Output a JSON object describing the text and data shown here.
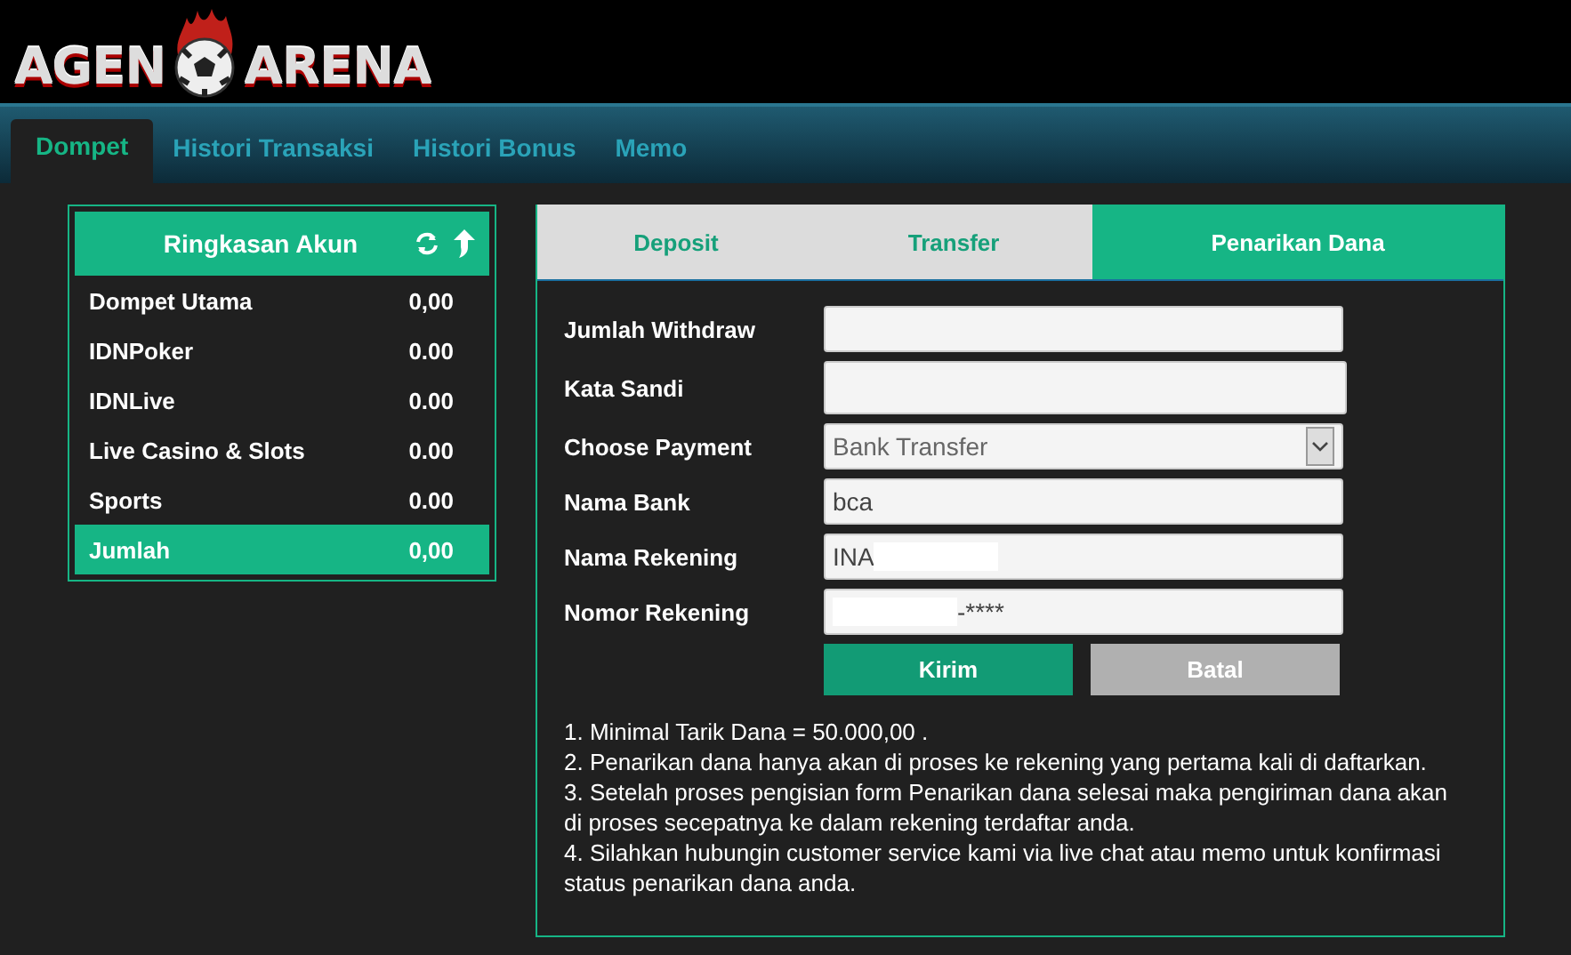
{
  "logo": {
    "left": "AGEN",
    "right": "ARENA"
  },
  "nav": [
    {
      "label": "Dompet",
      "selected": true
    },
    {
      "label": "Histori Transaksi",
      "selected": false
    },
    {
      "label": "Histori Bonus",
      "selected": false
    },
    {
      "label": "Memo",
      "selected": false
    }
  ],
  "summary": {
    "title": "Ringkasan Akun",
    "rows": [
      {
        "name": "Dompet Utama",
        "value": "0,00",
        "selected": false
      },
      {
        "name": "IDNPoker",
        "value": "0.00",
        "selected": false
      },
      {
        "name": "IDNLive",
        "value": "0.00",
        "selected": false
      },
      {
        "name": "Live Casino & Slots",
        "value": "0.00",
        "selected": false
      },
      {
        "name": "Sports",
        "value": "0.00",
        "selected": false
      },
      {
        "name": "Jumlah",
        "value": "0,00",
        "selected": true
      }
    ]
  },
  "tabs": [
    {
      "label": "Deposit",
      "selected": false
    },
    {
      "label": "Transfer",
      "selected": false
    },
    {
      "label": "Penarikan Dana",
      "selected": true
    }
  ],
  "form": [
    {
      "label": "Jumlah Withdraw",
      "kind": "text"
    },
    {
      "label": "Kata Sandi",
      "kind": "text"
    },
    {
      "label": "Choose Payment",
      "kind": "select",
      "value": "Bank Transfer"
    },
    {
      "label": "Nama Bank",
      "kind": "text",
      "value": "bca"
    },
    {
      "label": "Nama Rekening",
      "kind": "text",
      "value": "INA",
      "masked_tail": true
    },
    {
      "label": "Nomor Rekening",
      "kind": "text",
      "value": "-****",
      "masked_head": true
    }
  ],
  "buttons": [
    {
      "label": "Kirim",
      "kind": "primary"
    },
    {
      "label": "Batal",
      "kind": "secondary"
    }
  ],
  "notes": [
    "1. Minimal Tarik Dana = 50.000,00 .",
    "2. Penarikan dana hanya akan di proses ke rekening yang pertama kali di daftarkan.",
    "3. Setelah proses pengisian form Penarikan dana selesai maka pengiriman dana akan di proses secepatnya ke dalam rekening terdaftar anda.",
    "4. Silahkan hubungin customer service kami via live chat atau memo untuk konfirmasi status penarikan dana anda."
  ]
}
